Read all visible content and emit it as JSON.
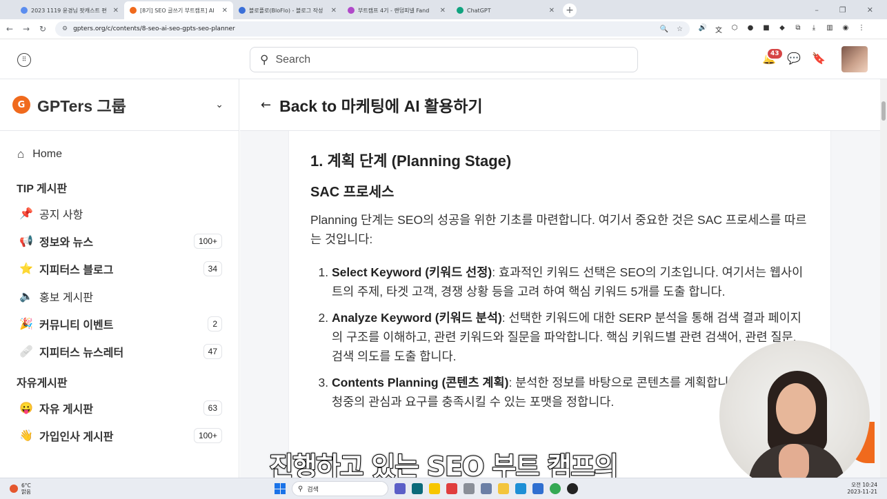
{
  "browser": {
    "tabs": [
      {
        "title": "2023 1119 윤경님 팟캐스트 편",
        "color": "#5b8def",
        "active": false
      },
      {
        "title": "[8기] SEO 글쓰기 부트캠프] AI",
        "color": "#f06a1d",
        "active": true
      },
      {
        "title": "블로플로(BloFlo) - 블로그 작성",
        "color": "#3a6fd8",
        "active": false
      },
      {
        "title": "부트캠프 4기 - 랜덤피넬 Fand",
        "color": "#b048c9",
        "active": false
      },
      {
        "title": "ChatGPT",
        "color": "#10a37f",
        "active": false
      }
    ],
    "new_tab_label": "+",
    "url": "gpters.org/c/contents/8-seo-ai-seo-gpts-seo-planner"
  },
  "header": {
    "search_placeholder": "Search",
    "notification_count": "43"
  },
  "sidebar": {
    "brand": "GPTers 그룹",
    "home_label": "Home",
    "sections": [
      {
        "heading": "TIP 게시판",
        "items": [
          {
            "emoji": "📌",
            "label": "공지 사항",
            "bold": false,
            "count": ""
          },
          {
            "emoji": "📢",
            "label": "정보와 뉴스",
            "bold": true,
            "count": "100+"
          },
          {
            "emoji": "⭐",
            "label": "지피터스 블로그",
            "bold": true,
            "count": "34"
          },
          {
            "emoji": "🔈",
            "label": "홍보 게시판",
            "bold": false,
            "count": ""
          },
          {
            "emoji": "🎉",
            "label": "커뮤니티 이벤트",
            "bold": true,
            "count": "2"
          },
          {
            "emoji": "🩹",
            "label": "지피터스 뉴스레터",
            "bold": true,
            "count": "47"
          }
        ]
      },
      {
        "heading": "자유게시판",
        "items": [
          {
            "emoji": "😛",
            "label": "자유 게시판",
            "bold": true,
            "count": "63"
          },
          {
            "emoji": "👋",
            "label": "가입인사 게시판",
            "bold": true,
            "count": "100+"
          }
        ]
      }
    ]
  },
  "main": {
    "back_label": "Back to 마케팅에 AI 활용하기",
    "article": {
      "h2": "1. 계획 단계 (Planning Stage)",
      "h3": "SAC 프로세스",
      "intro": "Planning 단계는 SEO의 성공을 위한 기초를 마련합니다. 여기서 중요한 것은 SAC 프로세스를 따르는 것입니다:",
      "steps": [
        {
          "term": "Select Keyword (키워드 선정)",
          "text": ": 효과적인 키워드 선택은 SEO의 기초입니다. 여기서는 웹사이트의 주제, 타겟 고객, 경쟁 상황 등을 고려 하여 핵심 키워드 5개를 도출 합니다."
        },
        {
          "term": "Analyze Keyword (키워드 분석)",
          "text": ": 선택한 키워드에 대한 SERP 분석을 통해 검색 결과 페이지의 구조를 이해하고, 관련 키워드와 질문을 파악합니다. 핵심 키워드별 관련 검색어, 관련 질문, 검색 의도를 도출 합니다."
        },
        {
          "term": "Contents Planning (콘텐츠 계획)",
          "text": ": 분석한 정보를 바탕으로 콘텐츠를 계획합니다. 이 때, 대상 청중의 관심과 요구를 충족시킬 수 있는 포맷을 정합니다."
        }
      ]
    }
  },
  "overlay": {
    "subtitle": "진행하고 있는 SEO 부트 캠프의"
  },
  "taskbar": {
    "temperature": "6°C",
    "weather": "맑음",
    "search_label": "검색",
    "time": "오전 10:24",
    "date": "2023-11-21"
  }
}
